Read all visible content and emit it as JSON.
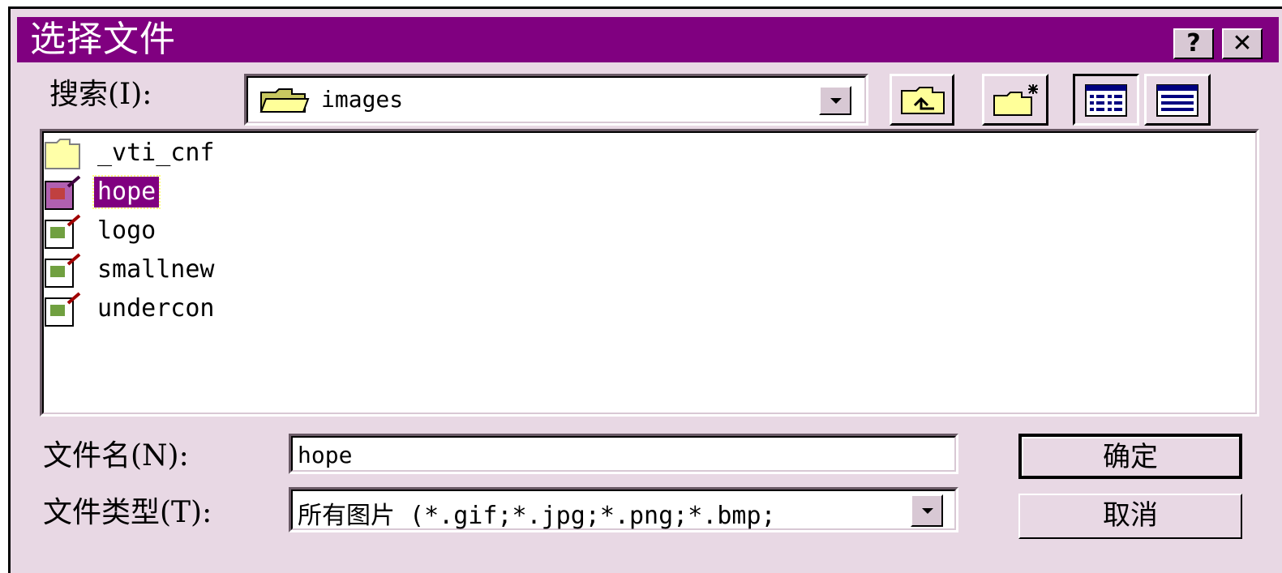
{
  "window": {
    "title": "选择文件",
    "help_label": "?",
    "close_label": "✕"
  },
  "lookin": {
    "label": "搜索(I):",
    "value": "images"
  },
  "files": [
    {
      "name": "_vti_cnf",
      "icon": "folder-icon",
      "selected": false
    },
    {
      "name": "hope",
      "icon": "image-file-icon",
      "selected": true
    },
    {
      "name": "logo",
      "icon": "image-file-icon",
      "selected": false
    },
    {
      "name": "smallnew",
      "icon": "image-file-icon",
      "selected": false
    },
    {
      "name": "undercon",
      "icon": "image-file-icon",
      "selected": false
    }
  ],
  "filename": {
    "label": "文件名(N):",
    "value": "hope"
  },
  "filetype": {
    "label": "文件类型(T):",
    "value": "所有图片 (*.gif;*.jpg;*.png;*.bmp;"
  },
  "buttons": {
    "ok": "确定",
    "cancel": "取消"
  },
  "colors": {
    "title_bar": "#800080",
    "selection": "#800080",
    "dialog_bg": "#e8d8e4"
  }
}
